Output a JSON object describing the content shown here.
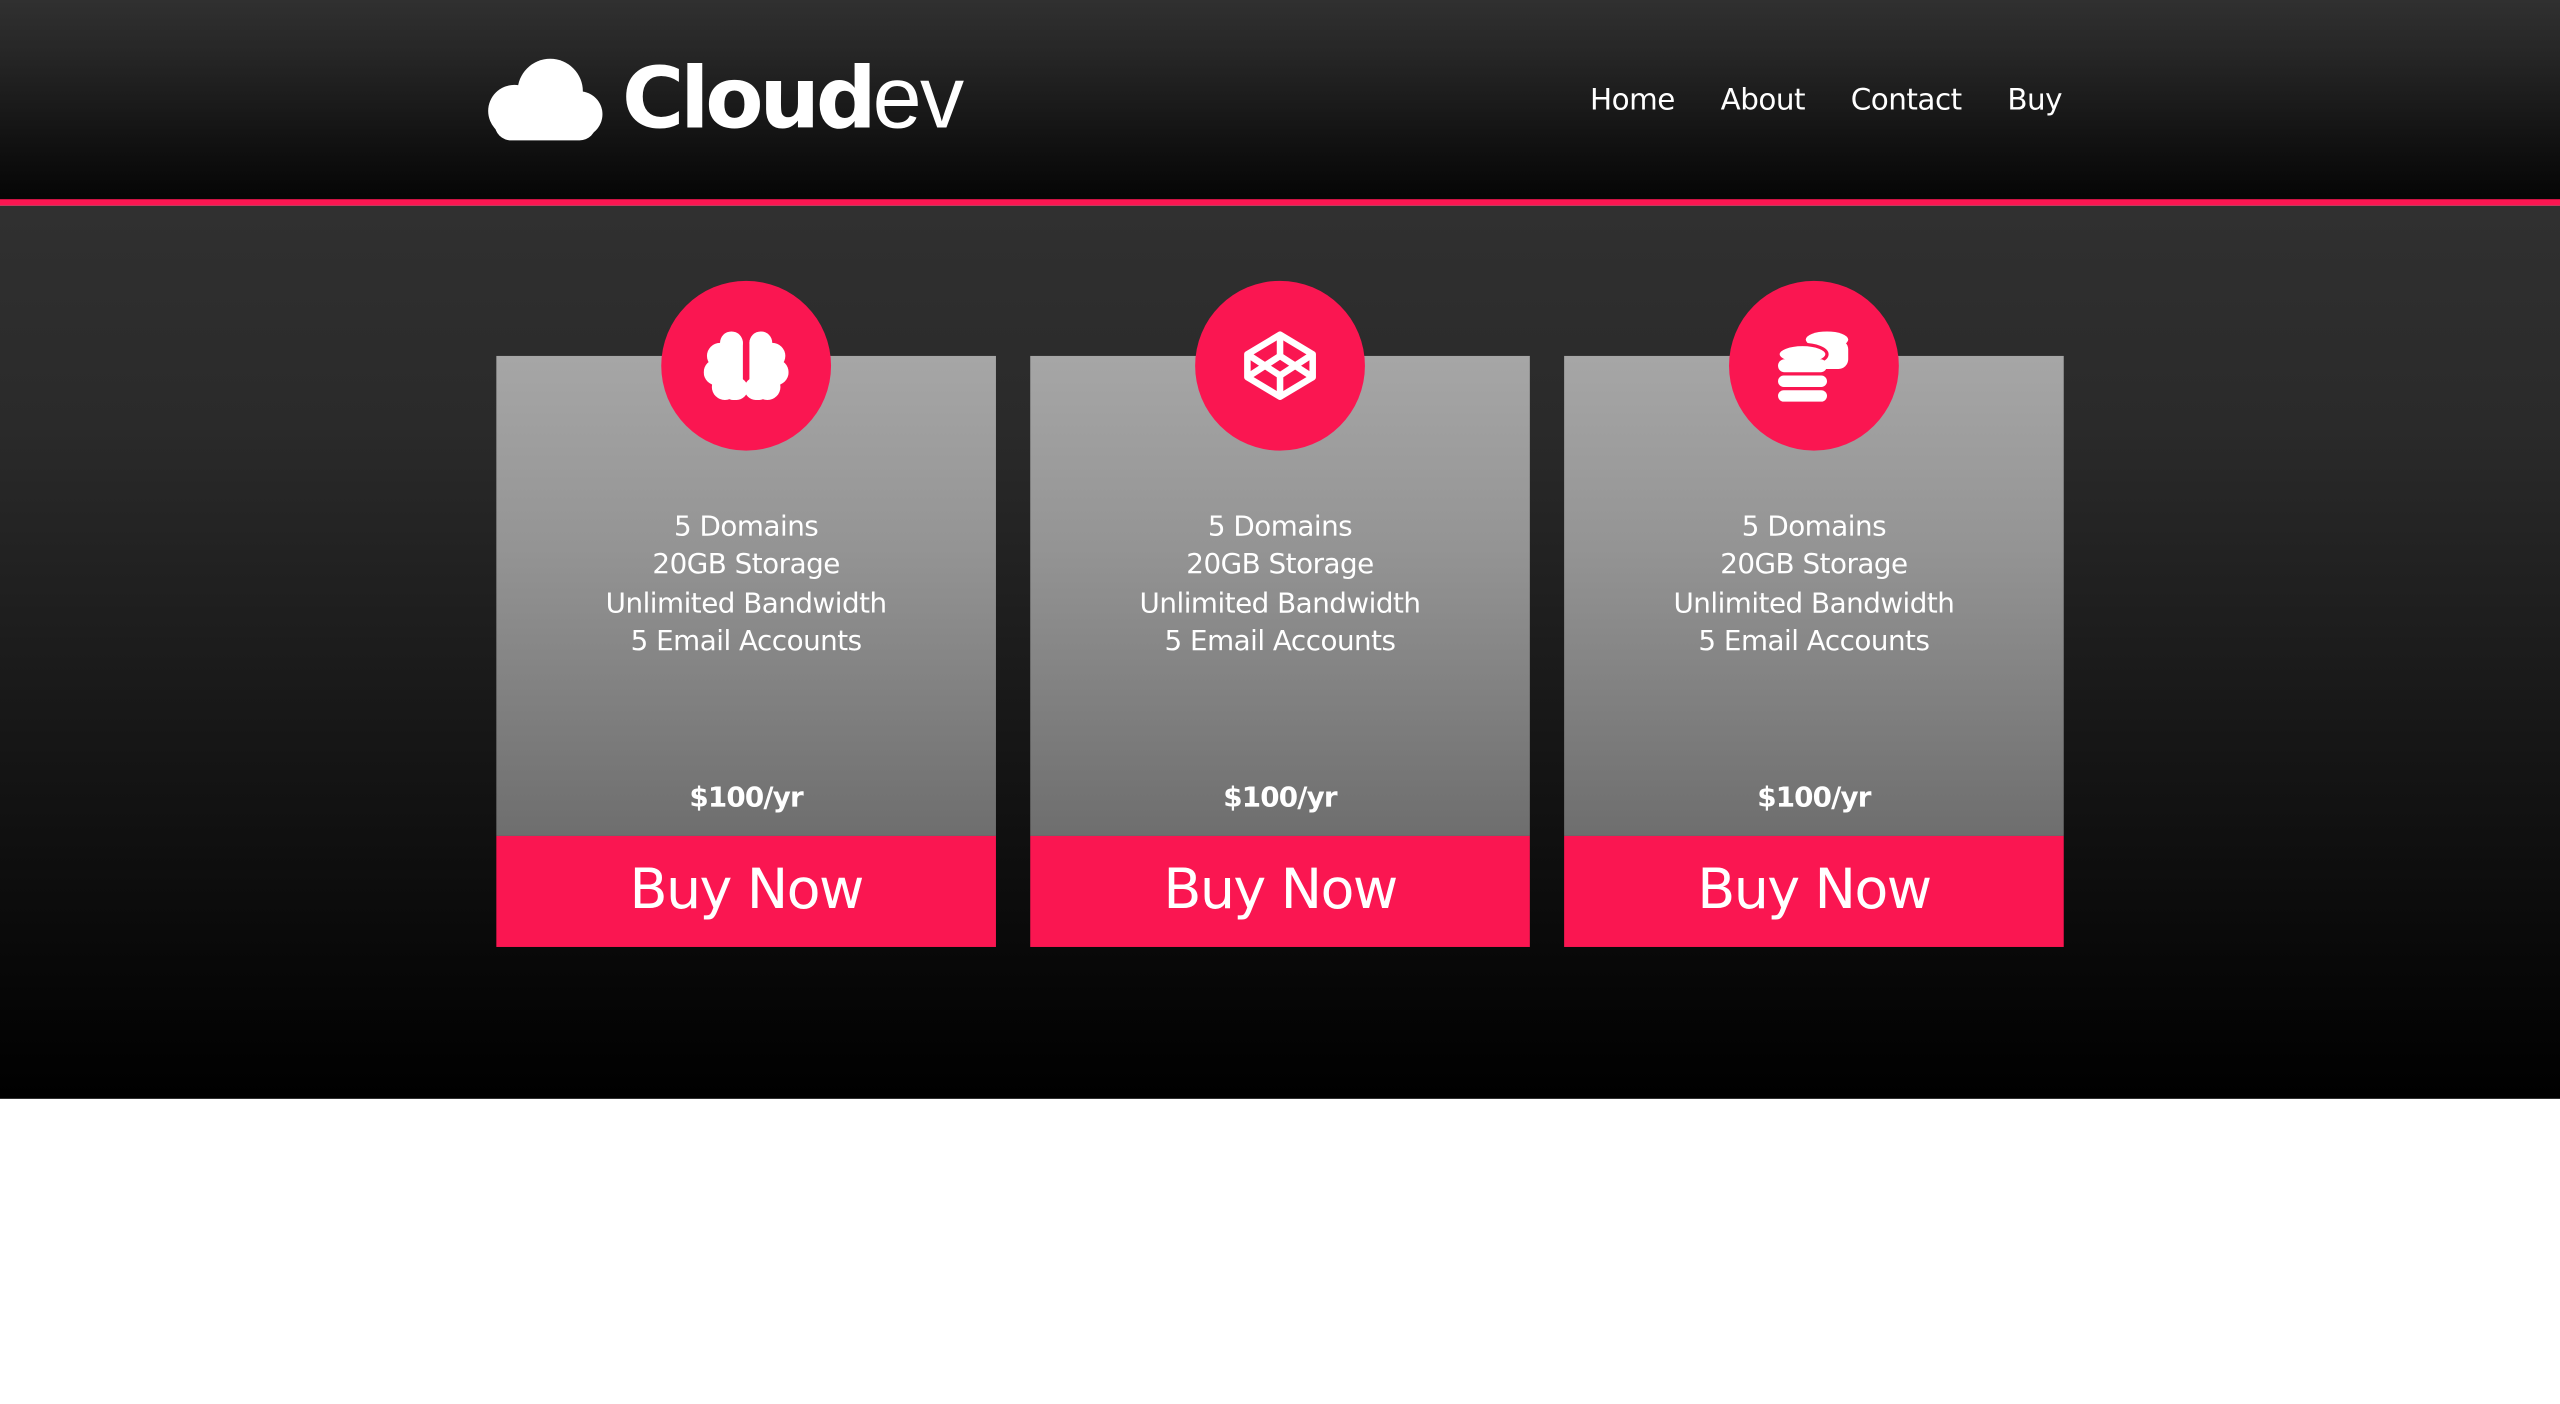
{
  "brand": {
    "name_bold": "Cloud",
    "name_light": "ev",
    "logo_icon": "cloud-icon"
  },
  "nav": {
    "items": [
      {
        "label": "Home"
      },
      {
        "label": "About"
      },
      {
        "label": "Contact"
      },
      {
        "label": "Buy"
      }
    ]
  },
  "plans": [
    {
      "icon": "brain-icon",
      "features": [
        "5 Domains",
        "20GB Storage",
        "Unlimited Bandwidth",
        "5 Email Accounts"
      ],
      "price": "$100/yr",
      "button_label": "Buy Now"
    },
    {
      "icon": "codepen-cube-icon",
      "features": [
        "5 Domains",
        "20GB Storage",
        "Unlimited Bandwidth",
        "5 Email Accounts"
      ],
      "price": "$100/yr",
      "button_label": "Buy Now"
    },
    {
      "icon": "coins-icon",
      "features": [
        "5 Domains",
        "20GB Storage",
        "Unlimited Bandwidth",
        "5 Email Accounts"
      ],
      "price": "$100/yr",
      "button_label": "Buy Now"
    }
  ],
  "colors": {
    "accent": "#fa1651",
    "header_dark": "#050505",
    "card_gray": "#a6a6a6",
    "text": "#ffffff"
  }
}
